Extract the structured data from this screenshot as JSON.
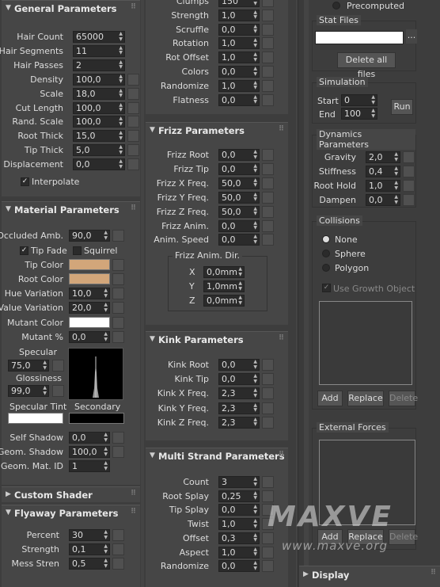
{
  "general": {
    "title": "General Parameters",
    "rows": [
      {
        "label": "Hair Count",
        "value": "65000"
      },
      {
        "label": "Hair Segments",
        "value": "11"
      },
      {
        "label": "Hair Passes",
        "value": "2"
      },
      {
        "label": "Density",
        "value": "100,0"
      },
      {
        "label": "Scale",
        "value": "18,0"
      },
      {
        "label": "Cut Length",
        "value": "100,0"
      },
      {
        "label": "Rand. Scale",
        "value": "100,0"
      },
      {
        "label": "Root Thick",
        "value": "15,0"
      },
      {
        "label": "Tip Thick",
        "value": "5,0"
      },
      {
        "label": "Displacement",
        "value": "0,0"
      }
    ],
    "interpolate": "Interpolate"
  },
  "material": {
    "title": "Material Parameters",
    "occluded": {
      "label": "Occluded Amb.",
      "value": "90,0"
    },
    "tip_fade": "Tip Fade",
    "squirrel": "Squirrel",
    "tip_color": "Tip Color",
    "root_color": "Root Color",
    "hue": {
      "label": "Hue Variation",
      "value": "10,0"
    },
    "valuevar": {
      "label": "Value Variation",
      "value": "20,0"
    },
    "mutant_color": "Mutant Color",
    "mutant_pct": {
      "label": "Mutant %",
      "value": "0,0"
    },
    "specular": {
      "label": "Specular",
      "value": "75,0"
    },
    "glossiness": {
      "label": "Glossiness",
      "value": "99,0"
    },
    "spec_tint": "Specular Tint",
    "secondary": "Secondary",
    "self_shadow": {
      "label": "Self Shadow",
      "value": "0,0"
    },
    "geom_shadow": {
      "label": "Geom. Shadow",
      "value": "100,0"
    },
    "geom_mat": {
      "label": "Geom. Mat. ID",
      "value": "1"
    },
    "colors": {
      "tip": "#d2a67a",
      "root": "#d2a67a",
      "mutant": "#ffffff",
      "spec_tint": "#ffffff",
      "secondary": "#000000"
    }
  },
  "custom_shader": {
    "title": "Custom Shader"
  },
  "flyaway": {
    "title": "Flyaway Parameters",
    "rows": [
      {
        "label": "Percent",
        "value": "30"
      },
      {
        "label": "Strength",
        "value": "0,1"
      },
      {
        "label": "Mess Stren",
        "value": "0,5"
      }
    ]
  },
  "clumps": {
    "rows": [
      {
        "label": "Clumps",
        "value": "150"
      },
      {
        "label": "Strength",
        "value": "1,0"
      },
      {
        "label": "Scruffle",
        "value": "0,0"
      },
      {
        "label": "Rotation",
        "value": "1,0"
      },
      {
        "label": "Rot Offset",
        "value": "1,0"
      },
      {
        "label": "Colors",
        "value": "0,0"
      },
      {
        "label": "Randomize",
        "value": "1,0"
      },
      {
        "label": "Flatness",
        "value": "0,0"
      }
    ]
  },
  "frizz": {
    "title": "Frizz Parameters",
    "rows": [
      {
        "label": "Frizz Root",
        "value": "0,0"
      },
      {
        "label": "Frizz Tip",
        "value": "0,0"
      },
      {
        "label": "Frizz X Freq.",
        "value": "50,0"
      },
      {
        "label": "Frizz Y Freq.",
        "value": "50,0"
      },
      {
        "label": "Frizz Z Freq.",
        "value": "50,0"
      },
      {
        "label": "Frizz Anim.",
        "value": "0,0"
      },
      {
        "label": "Anim. Speed",
        "value": "0,0"
      }
    ],
    "dir": {
      "title": "Frizz Anim. Dir.",
      "x": {
        "label": "X",
        "value": "0,0mm"
      },
      "y": {
        "label": "Y",
        "value": "1,0mm"
      },
      "z": {
        "label": "Z",
        "value": "0,0mm"
      }
    }
  },
  "kink": {
    "title": "Kink Parameters",
    "rows": [
      {
        "label": "Kink Root",
        "value": "0,0"
      },
      {
        "label": "Kink Tip",
        "value": "0,0"
      },
      {
        "label": "Kink X Freq.",
        "value": "2,3"
      },
      {
        "label": "Kink Y Freq.",
        "value": "2,3"
      },
      {
        "label": "Kink Z Freq.",
        "value": "2,3"
      }
    ]
  },
  "multi": {
    "title": "Multi Strand Parameters",
    "rows": [
      {
        "label": "Count",
        "value": "3"
      },
      {
        "label": "Root Splay",
        "value": "0,25"
      },
      {
        "label": "Tip Splay",
        "value": "0,0"
      },
      {
        "label": "Twist",
        "value": "1,0"
      },
      {
        "label": "Offset",
        "value": "0,3"
      },
      {
        "label": "Aspect",
        "value": "1,0"
      },
      {
        "label": "Randomize",
        "value": "0,0"
      }
    ]
  },
  "right": {
    "precomputed": "Precomputed",
    "stat_files": {
      "title": "Stat Files",
      "browse": "...",
      "delete_all": "Delete all files"
    },
    "simulation": {
      "title": "Simulation",
      "start": {
        "label": "Start",
        "value": "0"
      },
      "end": {
        "label": "End",
        "value": "100"
      },
      "run": "Run"
    },
    "dynamics": {
      "title": "Dynamics Parameters",
      "rows": [
        {
          "label": "Gravity",
          "value": "2,0"
        },
        {
          "label": "Stiffness",
          "value": "0,4"
        },
        {
          "label": "Root Hold",
          "value": "1,0"
        },
        {
          "label": "Dampen",
          "value": "0,0"
        }
      ]
    },
    "collisions": {
      "title": "Collisions",
      "none": "None",
      "sphere": "Sphere",
      "polygon": "Polygon",
      "use_growth": "Use Growth Object",
      "add": "Add",
      "replace": "Replace",
      "delete": "Delete"
    },
    "forces": {
      "title": "External Forces",
      "add": "Add",
      "replace": "Replace",
      "delete": "Delete"
    },
    "display": {
      "title": "Display"
    }
  },
  "watermark": {
    "logo": "MAXVE",
    "url": "www.maxve.org"
  }
}
